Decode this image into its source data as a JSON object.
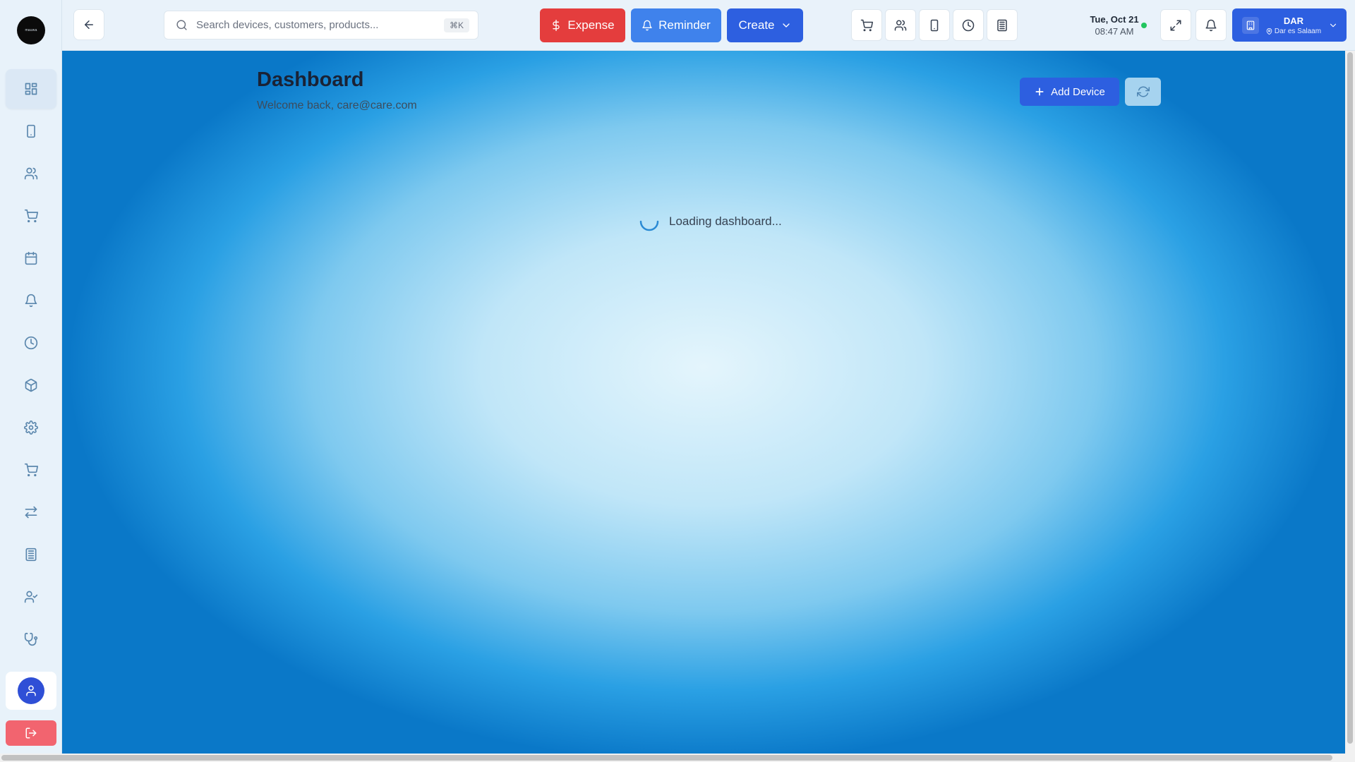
{
  "brand": {
    "logo_text": "mauwa"
  },
  "sidebar": {
    "items": [
      {
        "name": "dashboard",
        "icon": "grid-icon",
        "active": true
      },
      {
        "name": "devices",
        "icon": "phone-icon"
      },
      {
        "name": "customers",
        "icon": "users-icon"
      },
      {
        "name": "sales",
        "icon": "cart-icon"
      },
      {
        "name": "calendar",
        "icon": "calendar-icon"
      },
      {
        "name": "reminders",
        "icon": "bell-icon"
      },
      {
        "name": "history",
        "icon": "clock-icon"
      },
      {
        "name": "products",
        "icon": "package-icon"
      },
      {
        "name": "settings",
        "icon": "gear-icon"
      },
      {
        "name": "purchases",
        "icon": "cart-icon"
      },
      {
        "name": "transfers",
        "icon": "arrows-icon"
      },
      {
        "name": "branches",
        "icon": "building-icon"
      },
      {
        "name": "employees",
        "icon": "user-check-icon"
      },
      {
        "name": "diagnostics",
        "icon": "stethoscope-icon"
      }
    ]
  },
  "topbar": {
    "search_placeholder": "Search devices, customers, products...",
    "search_shortcut": "⌘K",
    "expense_label": "Expense",
    "reminder_label": "Reminder",
    "create_label": "Create",
    "date": "Tue, Oct 21",
    "time": "08:47 AM",
    "location_code": "DAR",
    "location_name": "Dar es Salaam"
  },
  "main": {
    "title": "Dashboard",
    "subtitle": "Welcome back, care@care.com",
    "add_device_label": "Add Device",
    "loading_text": "Loading dashboard..."
  },
  "colors": {
    "primary": "#2d5fe0",
    "expense": "#e43d3d",
    "reminder": "#3f82ec",
    "online": "#22c55e",
    "logout": "#f2646f"
  }
}
